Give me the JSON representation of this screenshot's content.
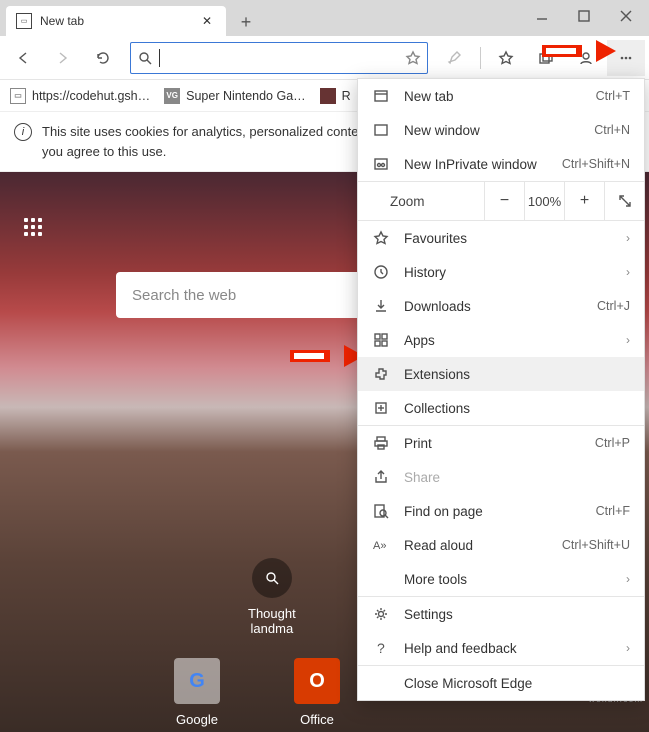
{
  "tab": {
    "title": "New tab"
  },
  "bookmarks": [
    {
      "label": "https://codehut.gsh…",
      "icon": "page"
    },
    {
      "label": "Super Nintendo Ga…",
      "icon": "VG"
    },
    {
      "label": "R",
      "icon": "img"
    }
  ],
  "infobar": {
    "text": "This site uses cookies for analytics, personalized content and ads. By continuing to browse this site, you agree to this use."
  },
  "search": {
    "placeholder": "Search the web"
  },
  "thought": {
    "line1": "Thought",
    "line2": "landma"
  },
  "tiles": [
    {
      "label": "Google",
      "letter": "G"
    },
    {
      "label": "Office",
      "letter": "O"
    }
  ],
  "zoom": {
    "label": "Zoom",
    "value": "100%"
  },
  "menu": {
    "newtab": {
      "label": "New tab",
      "shortcut": "Ctrl+T"
    },
    "newwin": {
      "label": "New window",
      "shortcut": "Ctrl+N"
    },
    "inprivate": {
      "label": "New InPrivate window",
      "shortcut": "Ctrl+Shift+N"
    },
    "favourites": {
      "label": "Favourites"
    },
    "history": {
      "label": "History"
    },
    "downloads": {
      "label": "Downloads",
      "shortcut": "Ctrl+J"
    },
    "apps": {
      "label": "Apps"
    },
    "extensions": {
      "label": "Extensions"
    },
    "collections": {
      "label": "Collections"
    },
    "print": {
      "label": "Print",
      "shortcut": "Ctrl+P"
    },
    "share": {
      "label": "Share"
    },
    "find": {
      "label": "Find on page",
      "shortcut": "Ctrl+F"
    },
    "readaloud": {
      "label": "Read aloud",
      "shortcut": "Ctrl+Shift+U"
    },
    "moretools": {
      "label": "More tools"
    },
    "settings": {
      "label": "Settings"
    },
    "help": {
      "label": "Help and feedback"
    },
    "close": {
      "label": "Close Microsoft Edge"
    }
  },
  "watermark": "woxdn.com"
}
